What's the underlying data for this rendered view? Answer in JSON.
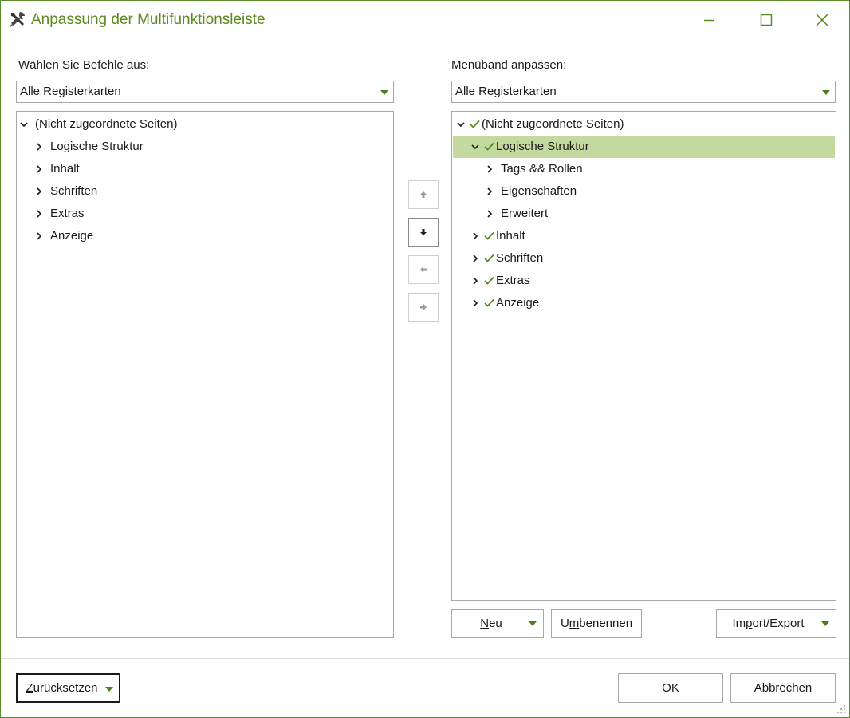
{
  "window": {
    "title": "Anpassung der Multifunktionsleiste",
    "accent_color": "#5b8a22",
    "selection_color": "#c3d9a0",
    "icons": {
      "app": "tools-icon",
      "minimize": "minimize-icon",
      "maximize": "maximize-icon",
      "close": "close-icon"
    }
  },
  "left": {
    "label": "Wählen Sie Befehle aus:",
    "combo_value": "Alle Registerkarten",
    "tree": [
      {
        "text": "(Nicht zugeordnete Seiten)",
        "expanded": true
      },
      {
        "text": "Logische Struktur",
        "expanded": false
      },
      {
        "text": "Inhalt",
        "expanded": false
      },
      {
        "text": "Schriften",
        "expanded": false
      },
      {
        "text": "Extras",
        "expanded": false
      },
      {
        "text": "Anzeige",
        "expanded": false
      }
    ]
  },
  "middle": {
    "buttons": [
      "move-up-icon",
      "move-down-icon",
      "move-left-icon",
      "move-right-icon"
    ]
  },
  "right": {
    "label": "Menüband anpassen:",
    "combo_value": "Alle Registerkarten",
    "tree": [
      {
        "text": "(Nicht zugeordnete Seiten)",
        "expanded": true,
        "checked": true,
        "selected": false
      },
      {
        "text": "Logische Struktur",
        "expanded": true,
        "checked": true,
        "selected": true
      },
      {
        "text": "Tags && Rollen",
        "expanded": false,
        "checked": false,
        "selected": false
      },
      {
        "text": "Eigenschaften",
        "expanded": false,
        "checked": false,
        "selected": false
      },
      {
        "text": "Erweitert",
        "expanded": false,
        "checked": false,
        "selected": false
      },
      {
        "text": "Inhalt",
        "expanded": false,
        "checked": true,
        "selected": false
      },
      {
        "text": "Schriften",
        "expanded": false,
        "checked": true,
        "selected": false
      },
      {
        "text": "Extras",
        "expanded": false,
        "checked": true,
        "selected": false
      },
      {
        "text": "Anzeige",
        "expanded": false,
        "checked": true,
        "selected": false
      }
    ],
    "buttons": {
      "new": {
        "mnemonic": "N",
        "rest": "eu"
      },
      "rename": {
        "before": "U",
        "mnemonic": "m",
        "rest": "benennen"
      },
      "import_export": {
        "before": "Im",
        "mnemonic": "p",
        "rest": "ort/Export"
      }
    }
  },
  "footer": {
    "reset": {
      "mnemonic": "Z",
      "rest": "urücksetzen"
    },
    "ok": "OK",
    "cancel": "Abbrechen"
  }
}
